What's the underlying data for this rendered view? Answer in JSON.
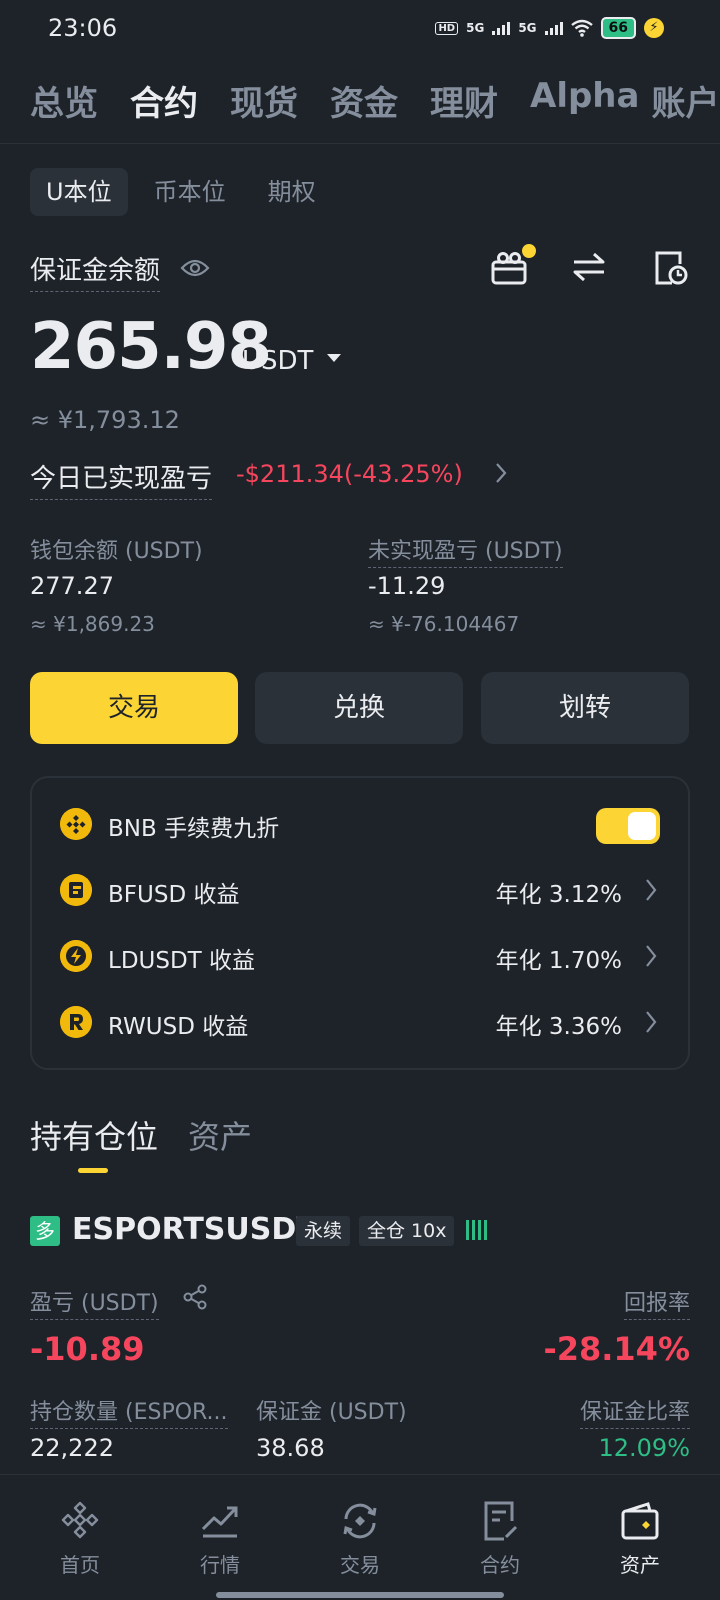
{
  "status_bar": {
    "time": "23:06",
    "hd": "HD",
    "net1": "5G",
    "net2": "5G",
    "battery": "66",
    "colors": {
      "battery": "#2ebd85",
      "charging": "#fcd535"
    }
  },
  "top_tabs": [
    {
      "label": "总览",
      "active": false
    },
    {
      "label": "合约",
      "active": true
    },
    {
      "label": "现货",
      "active": false
    },
    {
      "label": "资金",
      "active": false
    },
    {
      "label": "理财",
      "active": false
    },
    {
      "label": "Alpha",
      "active": false
    },
    {
      "label": "账户",
      "active": false
    }
  ],
  "sub_tabs": [
    {
      "label": "U本位",
      "active": true
    },
    {
      "label": "币本位",
      "active": false
    },
    {
      "label": "期权",
      "active": false
    }
  ],
  "margin": {
    "label": "保证金余额",
    "value": "265.98",
    "unit": "USDT",
    "cny": "≈ ¥1,793.12",
    "icons": [
      "eye-icon",
      "gift-icon",
      "swap-arrows-icon",
      "history-icon"
    ]
  },
  "today_pnl": {
    "label": "今日已实现盈亏",
    "value": "-$211.34(-43.25%)"
  },
  "wallet": {
    "label": "钱包余额 (USDT)",
    "value": "277.27",
    "cny": "≈ ¥1,869.23"
  },
  "unrealized": {
    "label": "未实现盈亏 (USDT)",
    "value": "-11.29",
    "cny": "≈ ¥-76.104467"
  },
  "actions": {
    "trade": "交易",
    "convert": "兑换",
    "transfer": "划转"
  },
  "earn": {
    "bnb_discount": {
      "label": "BNB 手续费九折",
      "enabled": true
    },
    "rows": [
      {
        "name": "BFUSD 收益",
        "rate": "年化 3.12%"
      },
      {
        "name": "LDUSDT 收益",
        "rate": "年化 1.70%"
      },
      {
        "name": "RWUSD 收益",
        "rate": "年化 3.36%"
      }
    ]
  },
  "section_tabs": {
    "positions": "持有仓位",
    "assets": "资产"
  },
  "position": {
    "side": "多",
    "symbol": "ESPORTSUSDT",
    "tag_perp": "永续",
    "tag_margin": "全仓 10x",
    "pnl_label": "盈亏 (USDT)",
    "pnl_value": "-10.89",
    "roe_label": "回报率",
    "roe_value": "-28.14%",
    "size_label": "持仓数量 (ESPOR...",
    "size_value": "22,222",
    "margin_label": "保证金 (USDT)",
    "margin_value": "38.68",
    "margin_ratio_label": "保证金比率",
    "margin_ratio_value": "12.09%"
  },
  "bottom_nav": [
    {
      "label": "首页",
      "icon": "binance-logo-icon",
      "active": false
    },
    {
      "label": "行情",
      "icon": "chart-trend-icon",
      "active": false
    },
    {
      "label": "交易",
      "icon": "trade-swap-icon",
      "active": false
    },
    {
      "label": "合约",
      "icon": "futures-document-icon",
      "active": false
    },
    {
      "label": "资产",
      "icon": "wallet-icon",
      "active": true
    }
  ],
  "colors": {
    "background": "#1e2329",
    "accent": "#fcd535",
    "negative": "#f6465d",
    "positive": "#2ebd85",
    "muted": "#848e9c"
  }
}
